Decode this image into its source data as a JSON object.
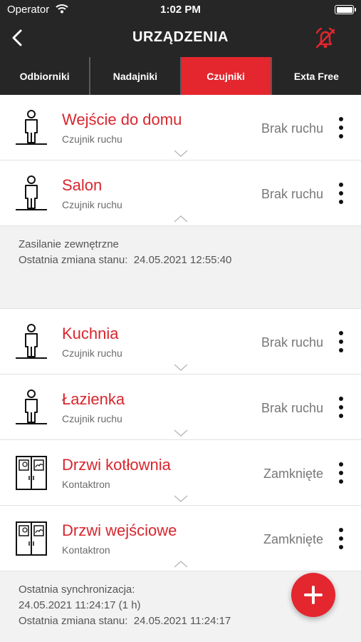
{
  "status_bar": {
    "carrier": "Operator",
    "time": "1:02 PM"
  },
  "nav": {
    "title": "URZĄDZENIA"
  },
  "tabs": [
    {
      "label": "Odbiorniki",
      "active": false
    },
    {
      "label": "Nadajniki",
      "active": false
    },
    {
      "label": "Czujniki",
      "active": true
    },
    {
      "label": "Exta Free",
      "active": false
    }
  ],
  "devices": [
    {
      "name": "Wejście do domu",
      "type": "Czujnik ruchu",
      "state": "Brak ruchu",
      "icon": "motion-sensor-icon",
      "expanded": false
    },
    {
      "name": "Salon",
      "type": "Czujnik ruchu",
      "state": "Brak ruchu",
      "icon": "motion-sensor-icon",
      "expanded": true,
      "details": [
        "Zasilanie zewnętrzne",
        "Ostatnia zmiana stanu:  24.05.2021 12:55:40"
      ]
    },
    {
      "name": "Kuchnia",
      "type": "Czujnik ruchu",
      "state": "Brak ruchu",
      "icon": "motion-sensor-icon",
      "expanded": false
    },
    {
      "name": "Łazienka",
      "type": "Czujnik ruchu",
      "state": "Brak ruchu",
      "icon": "motion-sensor-icon",
      "expanded": false
    },
    {
      "name": "Drzwi kotłownia",
      "type": "Kontaktron",
      "state": "Zamknięte",
      "icon": "door-contact-icon",
      "expanded": false
    },
    {
      "name": "Drzwi wejściowe",
      "type": "Kontaktron",
      "state": "Zamknięte",
      "icon": "door-contact-icon",
      "expanded": true,
      "details": [
        "Ostatnia synchronizacja:",
        "24.05.2021 11:24:17 (1 h)",
        "Ostatnia zmiana stanu:  24.05.2021 11:24:17"
      ]
    }
  ],
  "colors": {
    "accent": "#e4262e",
    "dark": "#262626",
    "name_text": "#d8262e"
  }
}
